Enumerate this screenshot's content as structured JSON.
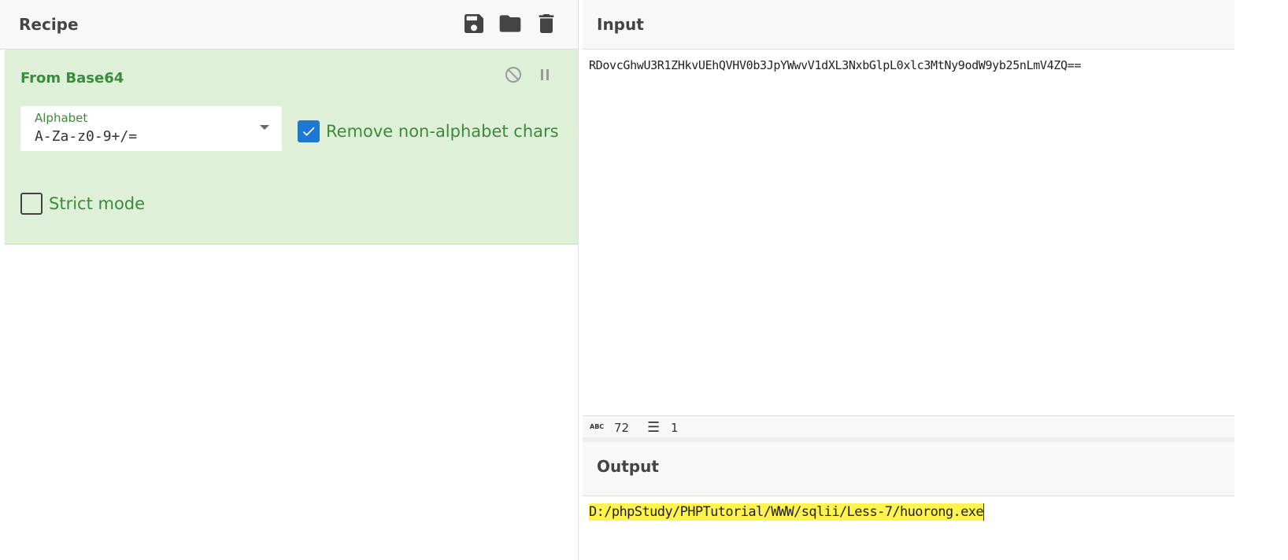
{
  "recipe": {
    "title": "Recipe",
    "icons": [
      "save-icon",
      "folder-icon",
      "trash-icon"
    ],
    "operation": {
      "title": "From Base64",
      "alphabet_label": "Alphabet",
      "alphabet_value": "A-Za-z0-9+/=",
      "remove_non_alphabet": {
        "label": "Remove non-alphabet chars",
        "checked": true
      },
      "strict_mode": {
        "label": "Strict mode",
        "checked": false
      }
    }
  },
  "input": {
    "title": "Input",
    "text": "RDovcGhwU3R1ZHkvUEhQVHV0b3JpYWwvV1dXL3NxbGlpL0xlc3MtNy9odW9yb25nLmV4ZQ==",
    "status": {
      "length": "72",
      "lines": "1"
    }
  },
  "output": {
    "title": "Output",
    "text": "D:/phpStudy/PHPTutorial/WWW/sqlii/Less-7/huorong.exe"
  },
  "colors": {
    "operation_bg": "#dff0d8",
    "operation_text": "#3c8a3c",
    "checkbox": "#1e78d2",
    "highlight": "#fff34f"
  }
}
